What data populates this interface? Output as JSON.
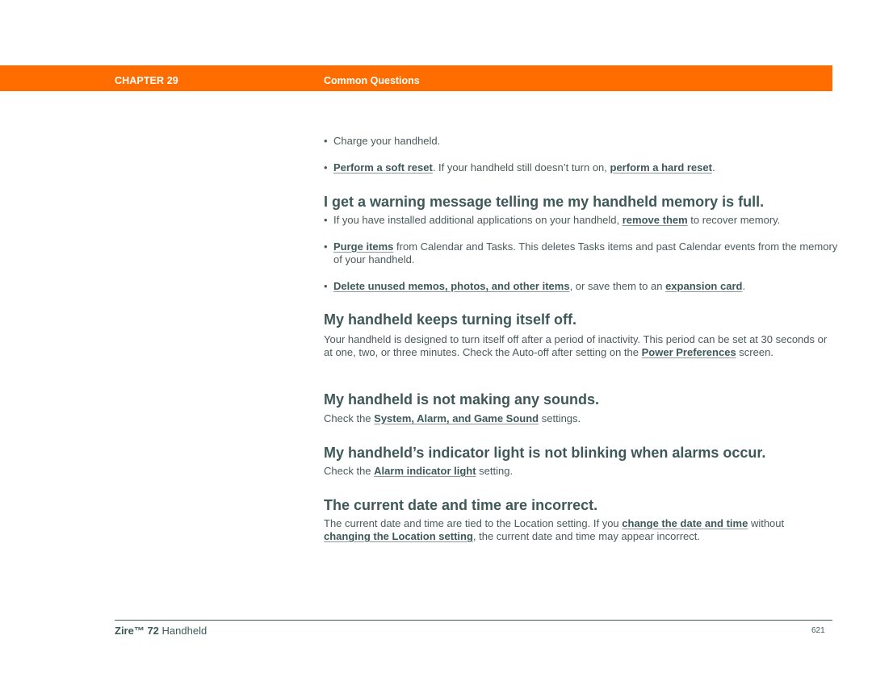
{
  "header": {
    "chapter_label": "CHAPTER 29",
    "chapter_title": "Common Questions",
    "bar_color": "#ff6d00"
  },
  "sections": {
    "intro_bullets": [
      {
        "text": "Charge your handheld."
      },
      {
        "link1": "Perform a soft reset",
        "mid": ". If your handheld still doesn’t turn on, ",
        "link2": "perform a hard reset",
        "end": "."
      }
    ],
    "memory": {
      "heading": "I get a warning message telling me my handheld memory is full.",
      "bullets": [
        {
          "pre": "If you have installed additional applications on your handheld, ",
          "link": "remove them",
          "post": " to recover memory."
        },
        {
          "link": "Purge items",
          "post": " from Calendar and Tasks. This deletes Tasks items and past Calendar events from the memory of your handheld."
        },
        {
          "link1": "Delete unused memos, photos, and other items",
          "mid": ", or save them to an ",
          "link2": "expansion card",
          "end": "."
        }
      ]
    },
    "auto_off": {
      "heading": "My handheld keeps turning itself off.",
      "pre": "Your handheld is designed to turn itself off after a period of inactivity. This period can be set at 30 seconds or at one, two, or three minutes. Check the Auto-off after setting on the ",
      "link": "Power Preferences",
      "post": " screen."
    },
    "sounds": {
      "heading": "My handheld is not making any sounds.",
      "pre": "Check the ",
      "link": "System, Alarm, and Game Sound",
      "post": " settings."
    },
    "indicator": {
      "heading": "My handheld’s indicator light is not blinking when alarms occur.",
      "pre": "Check the ",
      "link": "Alarm indicator light",
      "post": " setting."
    },
    "datetime": {
      "heading": "The current date and time are incorrect.",
      "pre": "The current date and time are tied to the Location setting. If you ",
      "link1": "change the date and time",
      "mid": " without ",
      "link2": "changing the Location setting",
      "post": ", the current date and time may appear incorrect."
    }
  },
  "footer": {
    "product_bold": "Zire™ 72",
    "product_rest": " Handheld",
    "page_number": "621"
  },
  "bullet_glyph": "•"
}
